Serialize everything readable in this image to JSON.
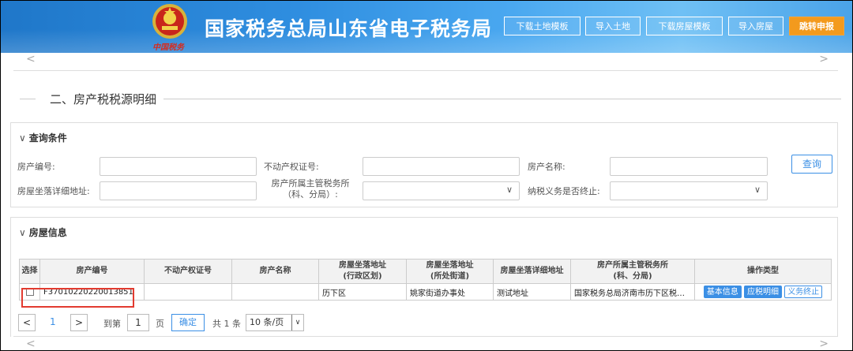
{
  "header": {
    "title": "国家税务总局山东省电子税务局",
    "emblem_script": "中国税务",
    "buttons": [
      {
        "label": "下载土地模板"
      },
      {
        "label": "导入土地"
      },
      {
        "label": "下载房屋模板"
      },
      {
        "label": "导入房屋"
      },
      {
        "label": "跳转申报"
      }
    ]
  },
  "scroll": {
    "left": "<",
    "right": ">"
  },
  "section": {
    "title": "二、房产税税源明细"
  },
  "query": {
    "panel_title": "查询条件",
    "caret": "∨",
    "fields": {
      "house_no": "房产编号:",
      "cert_no": "不动产权证号:",
      "house_name": "房产名称:",
      "address": "房屋坐落详细地址:",
      "tax_office_line1": "房产所属主管税务所",
      "tax_office_line2": "（科、分局）:",
      "terminated": "纳税义务是否终止:"
    },
    "search_label": "查询",
    "select_arrow": "∨"
  },
  "house_info": {
    "panel_title": "房屋信息",
    "caret": "∨",
    "columns": {
      "select": "选择",
      "house_no": "房产编号",
      "cert_no": "不动产权证号",
      "house_name": "房产名称",
      "district_l1": "房屋坐落地址",
      "district_l2": "(行政区划)",
      "street_l1": "房屋坐落地址",
      "street_l2": "(所处街道)",
      "detail": "房屋坐落详细地址",
      "office_l1": "房产所属主管税务所",
      "office_l2": "(科、分局)",
      "ops": "操作类型"
    },
    "rows": [
      {
        "house_no": "F37010220220013851",
        "cert_no": "",
        "house_name": "",
        "district": "历下区",
        "street": "姚家街道办事处",
        "detail": "测试地址",
        "office": "国家税务总局济南市历下区税务...",
        "ops": [
          "基本信息",
          "应税明细",
          "义务终止"
        ]
      }
    ]
  },
  "pager": {
    "prev": "<",
    "current": "1",
    "next": ">",
    "goto_label": "到第",
    "goto_value": "1",
    "page_unit": "页",
    "confirm": "确定",
    "total": "共 1 条",
    "page_size": "10 条/页"
  },
  "colors": {
    "accent": "#3b8fe5",
    "orange": "#f39a1d",
    "highlight": "#e23b30"
  }
}
